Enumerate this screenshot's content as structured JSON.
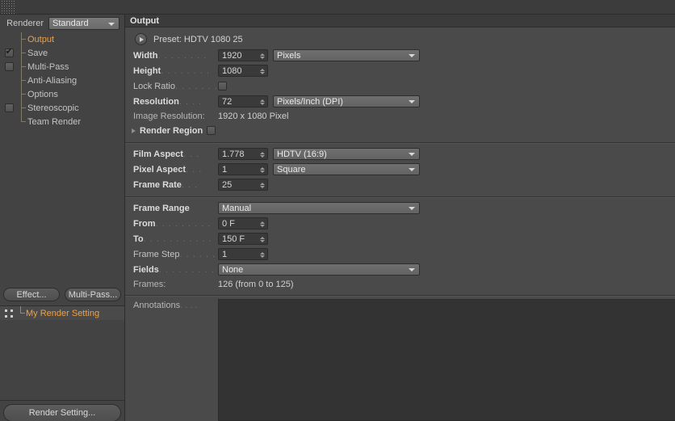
{
  "window": {
    "grip_icon": "drag-grip-icon"
  },
  "sidebar": {
    "renderer_label": "Renderer",
    "renderer_value": "Standard",
    "tree": [
      {
        "label": "Output",
        "selected": true,
        "checkbox": "none"
      },
      {
        "label": "Save",
        "selected": false,
        "checkbox": "checked"
      },
      {
        "label": "Multi-Pass",
        "selected": false,
        "checkbox": "unchecked"
      },
      {
        "label": "Anti-Aliasing",
        "selected": false,
        "checkbox": "none"
      },
      {
        "label": "Options",
        "selected": false,
        "checkbox": "none"
      },
      {
        "label": "Stereoscopic",
        "selected": false,
        "checkbox": "unchecked"
      },
      {
        "label": "Team Render",
        "selected": false,
        "checkbox": "none"
      }
    ],
    "effect_button": "Effect...",
    "multipass_button": "Multi-Pass...",
    "render_setting_item": "My Render Setting",
    "render_setting_button": "Render Setting..."
  },
  "main": {
    "header_title": "Output",
    "preset": {
      "button_icon": "preset-arrow-icon",
      "text": "Preset: HDTV 1080 25"
    },
    "width": {
      "label": "Width",
      "dots": ". . . . . . . .",
      "value": "1920",
      "unit": "Pixels"
    },
    "height": {
      "label": "Height",
      "dots": ". . . . . . . .",
      "value": "1080"
    },
    "lock_ratio": {
      "label": "Lock Ratio",
      "dots": ". . . . . . .",
      "checked": false
    },
    "resolution": {
      "label": "Resolution",
      "dots": ". . . .",
      "value": "72",
      "unit": "Pixels/Inch (DPI)"
    },
    "image_resolution": {
      "label": "Image Resolution:",
      "value": "1920 x 1080 Pixel"
    },
    "render_region": {
      "label": "Render Region",
      "checked": false,
      "arrow_icon": "expand-arrow-icon"
    },
    "film_aspect": {
      "label": "Film Aspect",
      "dots": ". . .",
      "value": "1.778",
      "preset": "HDTV (16:9)"
    },
    "pixel_aspect": {
      "label": "Pixel Aspect",
      "dots": ". . .",
      "value": "1",
      "preset": "Square"
    },
    "frame_rate": {
      "label": "Frame Rate",
      "dots": ". . .",
      "value": "25"
    },
    "frame_range": {
      "label": "Frame Range",
      "value": "Manual"
    },
    "from": {
      "label": "From",
      "dots": ". . . . . . . . .",
      "value": "0 F"
    },
    "to": {
      "label": "To",
      "dots": ". . . . . . . . . . .",
      "value": "150 F"
    },
    "frame_step": {
      "label": "Frame Step",
      "dots": ". . . . . .",
      "value": "1"
    },
    "fields": {
      "label": "Fields",
      "dots": ". . . . . . . . .",
      "value": "None"
    },
    "frames": {
      "label": "Frames:",
      "value": "126 (from 0 to 125)"
    },
    "annotations": {
      "label": "Annotations",
      "dots": ". . . .",
      "value": ""
    }
  },
  "colors": {
    "panel_bg": "#4a4a4a",
    "sidebar_bg": "#434343",
    "header_bg": "#3b3b3b",
    "field_bg": "#3a3a3a",
    "accent_orange": "#f0a040",
    "text": "#c8c8c8"
  }
}
